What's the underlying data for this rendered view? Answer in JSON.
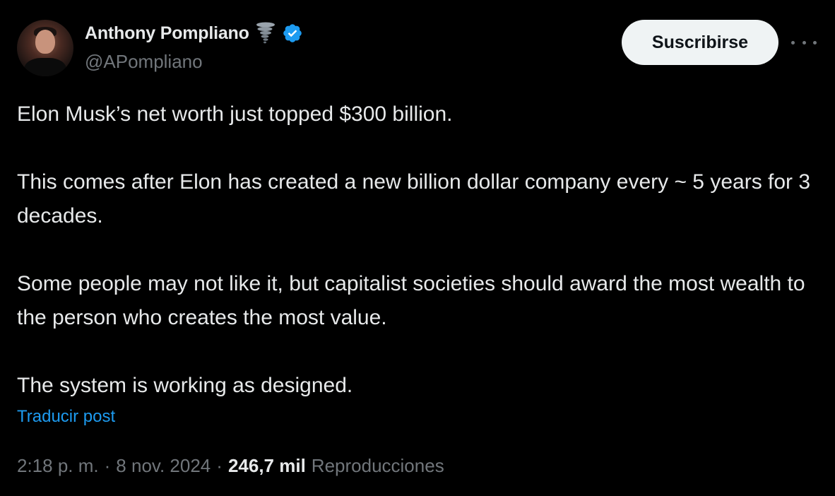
{
  "author": {
    "name": "Anthony Pompliano",
    "handle": "@APompliano",
    "emoji_icon": "tornado-icon",
    "verified_icon": "verified-badge-icon"
  },
  "actions": {
    "subscribe_label": "Suscribirse",
    "more_icon": "more-horizontal-icon"
  },
  "tweet": {
    "paragraphs": [
      "Elon Musk’s net worth just topped $300 billion.",
      "This comes after Elon has created a new billion dollar company every ~ 5 years for 3 decades.",
      "Some people may not like it, but capitalist societies should award the most wealth to the person who creates the most value.",
      "The system is working as designed."
    ],
    "translate_label": "Traducir post"
  },
  "meta": {
    "time": "2:18 p. m.",
    "separator": "·",
    "date": "8 nov. 2024",
    "views_count": "246,7 mil",
    "views_label": "Reproducciones"
  },
  "colors": {
    "background": "#000000",
    "text_primary": "#e7e9ea",
    "text_secondary": "#71767b",
    "link": "#1d9bf0",
    "verified": "#1d9bf0",
    "button_bg": "#eff3f4"
  }
}
